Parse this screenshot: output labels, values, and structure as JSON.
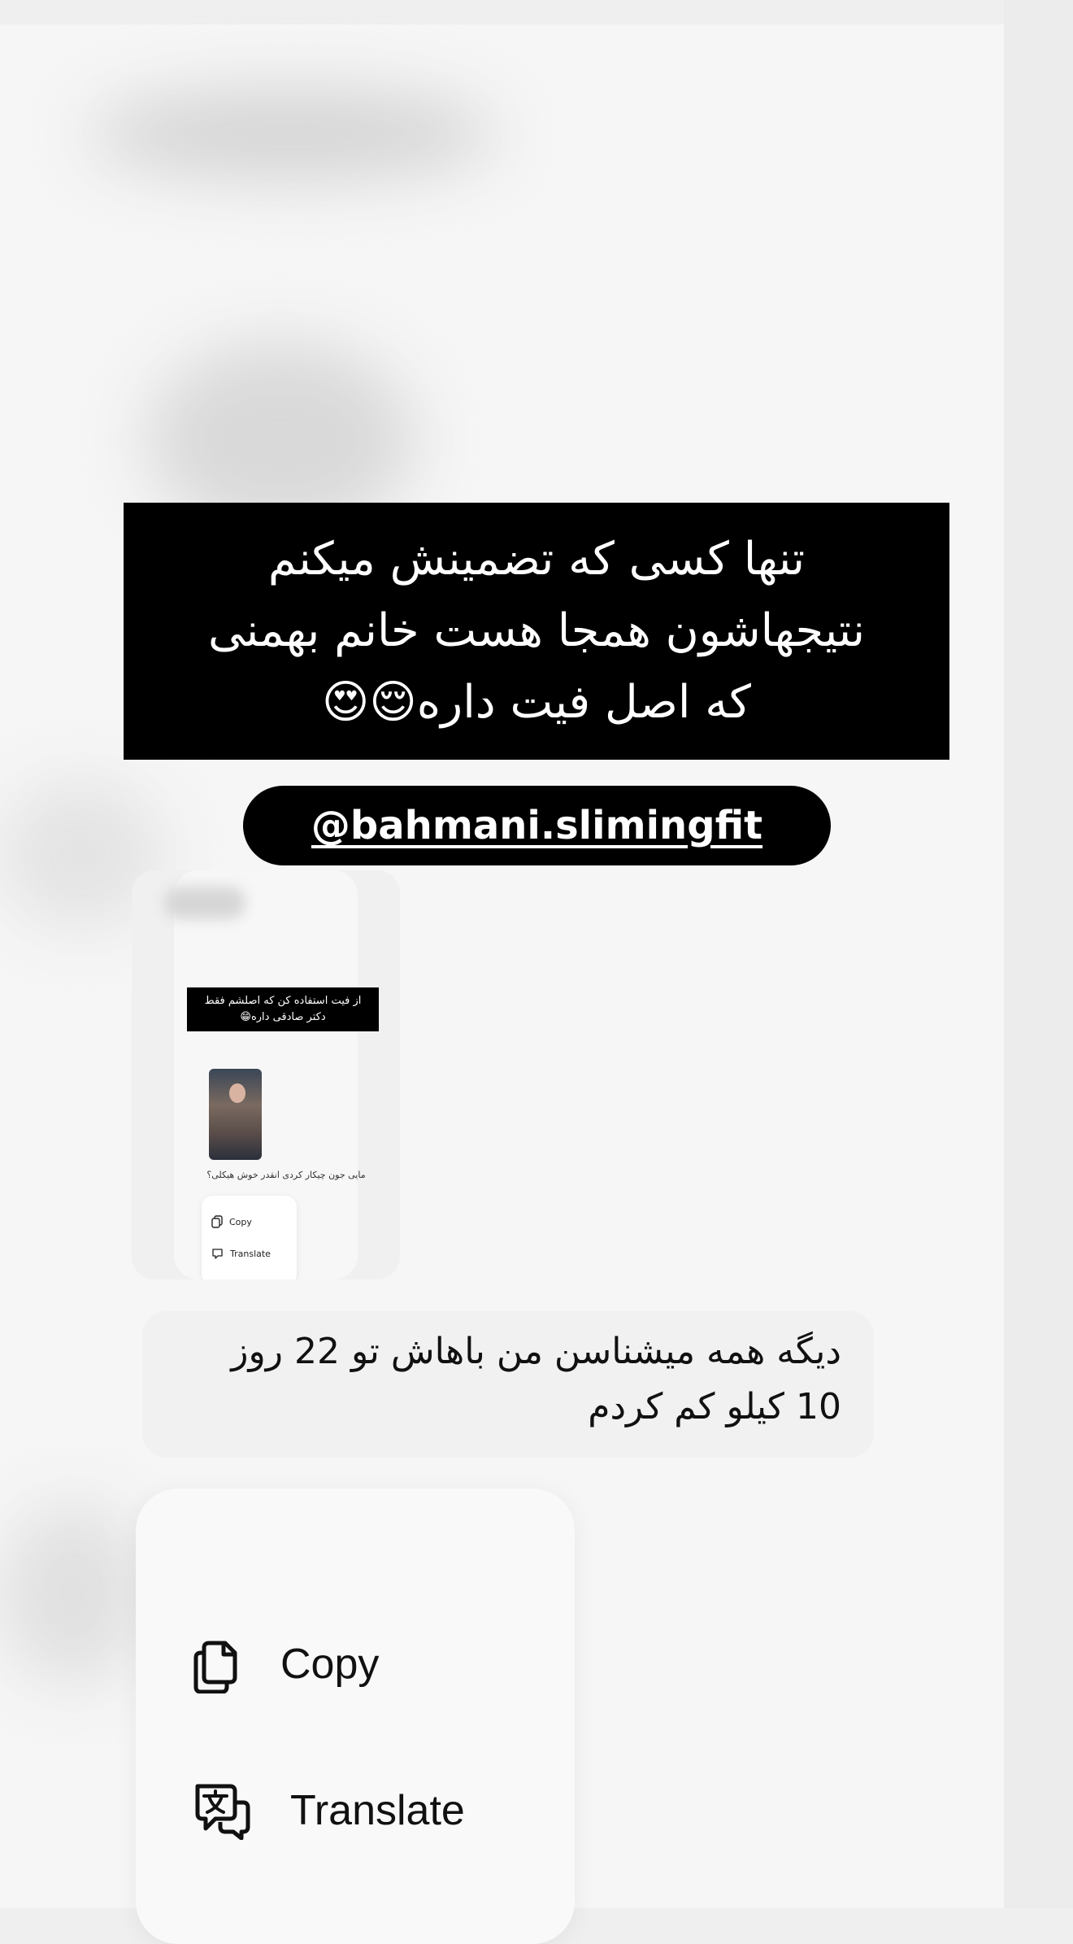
{
  "story": {
    "caption_lines": [
      "تنها کسی که تضمینش میکنم",
      "نتیجهاشون همجا هست خانم بهمنی",
      "که اصل فیت داره😌😍"
    ],
    "mention": "@bahmani.slimingfit"
  },
  "thumbnail": {
    "caption_lines": [
      "از فیت استفاده کن که اصلشم فقط",
      "دکتر صادقی داره😁"
    ],
    "reply_text": "مایی جون چیکار کردی انقدر خوش هیکلی؟",
    "menu": {
      "copy_label": "Copy",
      "translate_label": "Translate"
    }
  },
  "message": {
    "lines": [
      "دیگه همه میشناسن من باهاش تو 22 روز",
      "10 کیلو کم کردم"
    ]
  },
  "context_menu": {
    "copy_label": "Copy",
    "translate_label": "Translate",
    "copy_icon": "copy-icon",
    "translate_icon": "translate-icon"
  },
  "colors": {
    "background": "#f6f6f6",
    "caption_bg": "#000000",
    "text": "#111111"
  }
}
